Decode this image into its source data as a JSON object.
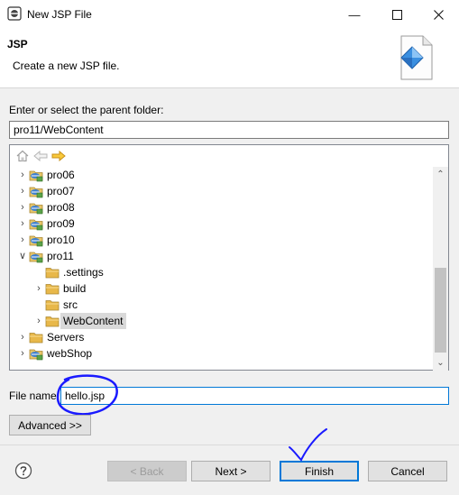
{
  "window": {
    "title": "New JSP File"
  },
  "icons": {
    "app": "eclipse-icon",
    "banner": "jsp-file-wizard-icon",
    "minimize": "minimize-icon",
    "maximize": "maximize-icon",
    "close": "close-icon",
    "home": "home-icon",
    "back": "back-arrow-icon",
    "forward": "forward-arrow-icon",
    "help": "help-icon"
  },
  "banner": {
    "title": "JSP",
    "description": "Create a new JSP file."
  },
  "folder": {
    "label": "Enter or select the parent folder:",
    "value": "pro11/WebContent"
  },
  "tree": {
    "items": [
      {
        "label": "pro06",
        "chevron": ">",
        "type": "project",
        "depth": 0
      },
      {
        "label": "pro07",
        "chevron": ">",
        "type": "project",
        "depth": 0
      },
      {
        "label": "pro08",
        "chevron": ">",
        "type": "project",
        "depth": 0
      },
      {
        "label": "pro09",
        "chevron": ">",
        "type": "project",
        "depth": 0
      },
      {
        "label": "pro10",
        "chevron": ">",
        "type": "project",
        "depth": 0
      },
      {
        "label": "pro11",
        "chevron": "v",
        "type": "project",
        "depth": 0
      },
      {
        "label": ".settings",
        "chevron": "",
        "type": "folder",
        "depth": 1
      },
      {
        "label": "build",
        "chevron": ">",
        "type": "folder",
        "depth": 1
      },
      {
        "label": "src",
        "chevron": "",
        "type": "folder",
        "depth": 1
      },
      {
        "label": "WebContent",
        "chevron": ">",
        "type": "folder",
        "depth": 1,
        "selected": true
      },
      {
        "label": "Servers",
        "chevron": ">",
        "type": "folder",
        "depth": 0
      },
      {
        "label": "webShop",
        "chevron": ">",
        "type": "project",
        "depth": 0
      }
    ]
  },
  "filename": {
    "label": "File name:",
    "value": "hello.jsp"
  },
  "buttons": {
    "advanced": "Advanced >>",
    "back": "< Back",
    "next": "Next >",
    "finish": "Finish",
    "cancel": "Cancel"
  },
  "colors": {
    "accent": "#0078d7",
    "annotation": "#1a1aff",
    "folder": "#e8b84a",
    "selection": "#d9d9d9"
  }
}
